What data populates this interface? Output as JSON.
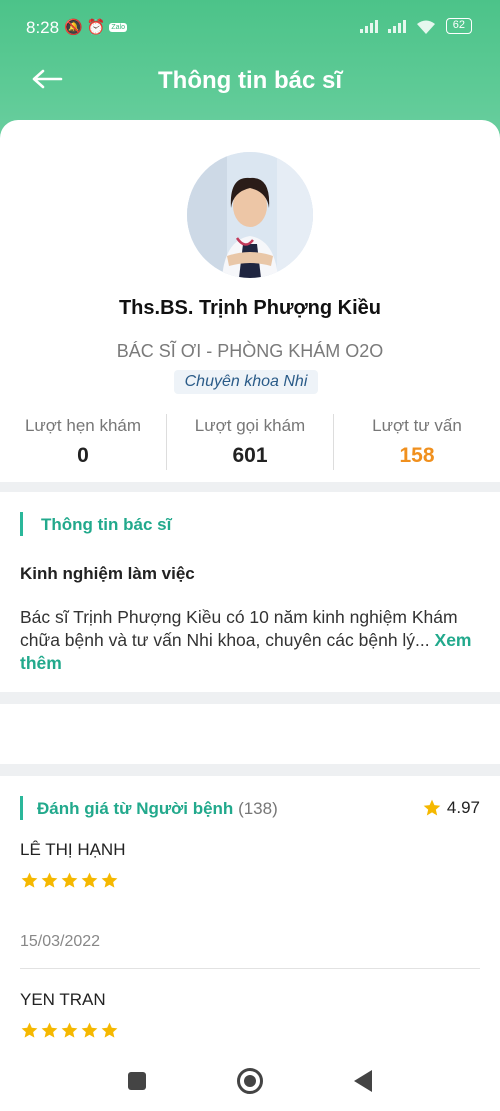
{
  "status_bar": {
    "time": "8:28",
    "battery": "62"
  },
  "header": {
    "title": "Thông tin bác sĩ"
  },
  "doctor": {
    "name": "Ths.BS. Trịnh Phượng Kiều",
    "clinic": "BÁC SĨ ƠI - PHÒNG KHÁM O2O",
    "specialty": "Chuyên khoa Nhi"
  },
  "stats": [
    {
      "label": "Lượt hẹn khám",
      "value": "0"
    },
    {
      "label": "Lượt gọi khám",
      "value": "601"
    },
    {
      "label": "Lượt tư vấn",
      "value": "158"
    }
  ],
  "info": {
    "section_title": "Thông tin bác sĩ",
    "experience_heading": "Kinh nghiệm làm việc",
    "experience_text": "Bác sĩ Trịnh Phượng  Kiều có 10 năm kinh nghiệm Khám chữa bệnh và tư vấn Nhi khoa, chuyên các bệnh lý...",
    "see_more": "Xem thêm"
  },
  "reviews": {
    "section_title": "Đánh giá từ Người bệnh",
    "count": "(138)",
    "average": "4.97",
    "items": [
      {
        "name": "LÊ THỊ HẠNH",
        "stars": 5,
        "date": "15/03/2022"
      },
      {
        "name": "YEN TRAN",
        "stars": 5
      }
    ]
  },
  "colors": {
    "brand_green": "#4cc389",
    "accent_teal": "#22a98c",
    "highlight_orange": "#f0901e",
    "star_gold": "#f5b800"
  },
  "icons": [
    "back-arrow-icon",
    "star-icon",
    "nav-recents-icon",
    "nav-home-icon",
    "nav-back-icon"
  ]
}
